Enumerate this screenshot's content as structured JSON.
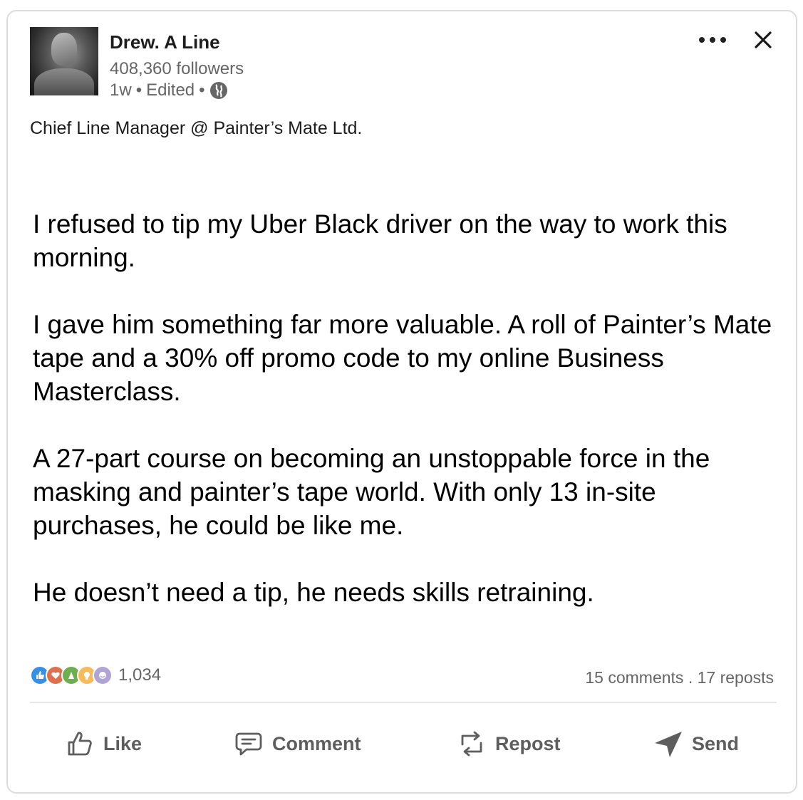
{
  "post": {
    "author": {
      "name": "Drew. A Line",
      "followers": "408,360 followers",
      "time": "1w",
      "edited": "Edited",
      "separator": "•",
      "headline": "Chief Line Manager @ Painter’s Mate Ltd."
    },
    "body": [
      "I refused to tip my Uber Black driver on the way to work this morning.",
      "I gave him something far more valuable. A roll of Painter’s Mate tape and a 30% off promo code to my online Business Masterclass.",
      "A 27-part course on becoming an unstoppable force in the masking and painter’s tape world. With only 13 in-site purchases, he could be like me.",
      "He doesn’t need a tip, he needs skills retraining."
    ],
    "reactions": {
      "count": "1,034",
      "icons": [
        {
          "name": "like-reaction-icon",
          "color": "#378fe9",
          "glyph": "👍"
        },
        {
          "name": "love-reaction-icon",
          "color": "#df704d",
          "glyph": "♥"
        },
        {
          "name": "celebrate-reaction-icon",
          "color": "#6dae4f",
          "glyph": "✦"
        },
        {
          "name": "insightful-reaction-icon",
          "color": "#f5bb5c",
          "glyph": "💡"
        },
        {
          "name": "funny-reaction-icon",
          "color": "#b0a4d6",
          "glyph": "☺"
        }
      ]
    },
    "stats": "15 comments . 17 reposts"
  },
  "actions": {
    "like": "Like",
    "comment": "Comment",
    "repost": "Repost",
    "send": "Send"
  },
  "icons": {
    "more": "more-icon",
    "close": "close-icon",
    "globe": "globe-icon"
  },
  "colors": {
    "text_secondary": "#666666",
    "action_text": "#5e5e5e",
    "divider": "#e6e6e6"
  }
}
